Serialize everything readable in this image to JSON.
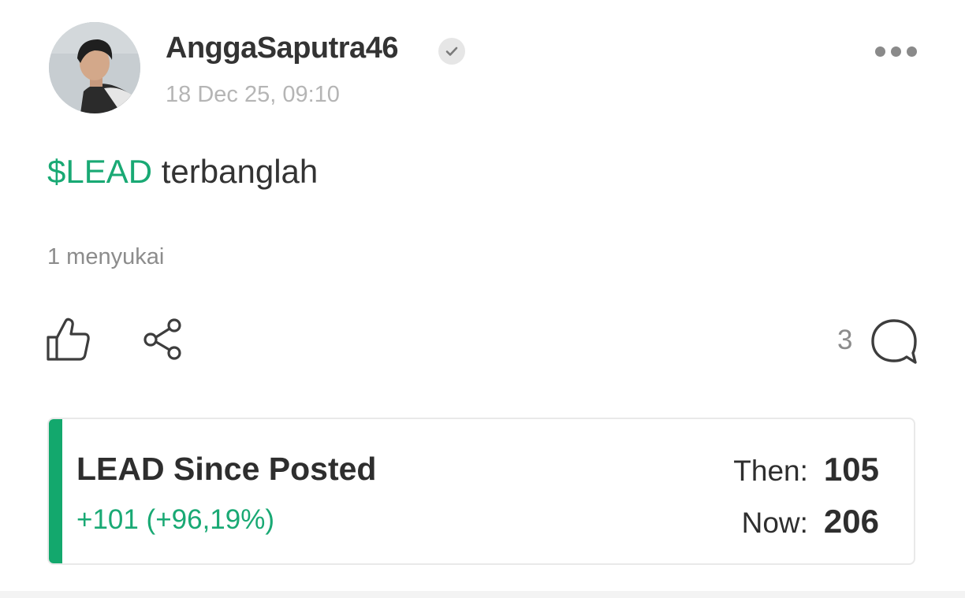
{
  "post": {
    "author": {
      "username": "AnggaSaputra46",
      "avatar": "user-photo",
      "verified_icon": "check-icon"
    },
    "timestamp": "18 Dec 25, 09:10",
    "more_icon": "more-horizontal-icon",
    "body": {
      "cashtag": "$LEAD",
      "text": " terbanglah"
    },
    "likes_label": "1 menyukai",
    "actions": {
      "like_icon": "thumbs-up-icon",
      "share_icon": "share-icon",
      "comment_icon": "comment-bubble-icon",
      "comment_count": "3"
    }
  },
  "stock_card": {
    "title": "LEAD Since Posted",
    "change": "+101 (+96,19%)",
    "then_label": "Then:",
    "then_value": "105",
    "now_label": "Now:",
    "now_value": "206"
  },
  "colors": {
    "accent_green": "#19a974",
    "card_bar_green": "#13a86d",
    "text_dark": "#333333",
    "text_muted": "#8c8c8c",
    "timestamp_gray": "#b5b5b5"
  }
}
